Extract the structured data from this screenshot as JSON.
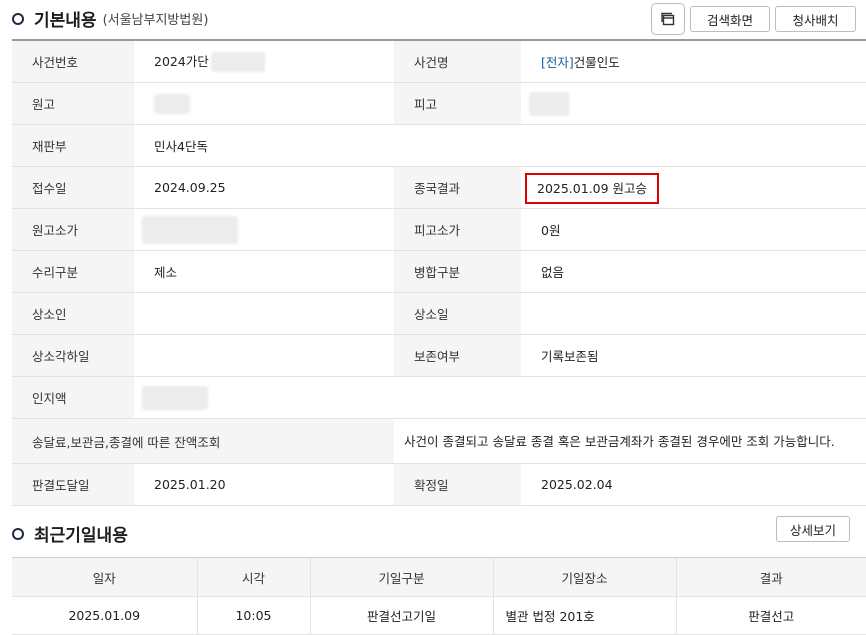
{
  "basic": {
    "title": "기본내용",
    "court": "(서울남부지방법원)",
    "search_screen_label": "검색화면",
    "dispatch_label": "청사배치",
    "print_icon": "window-icon",
    "rows": {
      "case_no_label": "사건번호",
      "case_no_value": "2024가단",
      "case_name_label": "사건명",
      "case_name_tag": "[전자]",
      "case_name_value": "건물인도",
      "plaintiff_label": "원고",
      "defendant_label": "피고",
      "court_dept_label": "재판부",
      "court_dept_value": "민사4단독",
      "received_label": "접수일",
      "received_value": "2024.09.25",
      "final_result_label": "종국결과",
      "final_result_value": "2025.01.09 원고승",
      "plaintiff_amount_label": "원고소가",
      "defendant_amount_label": "피고소가",
      "defendant_amount_value": "0원",
      "acceptance_label": "수리구분",
      "acceptance_value": "제소",
      "merge_label": "병합구분",
      "merge_value": "없음",
      "appellant_label": "상소인",
      "appeal_date_label": "상소일",
      "appeal_dismiss_label": "상소각하일",
      "preservation_label": "보존여부",
      "preservation_value": "기록보존됨",
      "stamp_label": "인지액",
      "balance_label": "송달료,보관금,종결에 따른 잔액조회",
      "balance_note": "사건이 종결되고 송달료 종결 혹은 보관금계좌가 종결된 경우에만 조회 가능합니다.",
      "judgment_delivery_label": "판결도달일",
      "judgment_delivery_value": "2025.01.20",
      "confirmed_label": "확정일",
      "confirmed_value": "2025.02.04"
    }
  },
  "schedule": {
    "title": "최근기일내용",
    "detail_label": "상세보기",
    "columns": [
      "일자",
      "시각",
      "기일구분",
      "기일장소",
      "결과"
    ],
    "rows": [
      [
        "2025.01.09",
        "10:05",
        "판결선고기일",
        "별관 법정 201호",
        "판결선고"
      ]
    ]
  },
  "colors": {
    "highlight": "#e00000",
    "link": "#1b5fa0",
    "header_bg": "#f5f5f5"
  }
}
